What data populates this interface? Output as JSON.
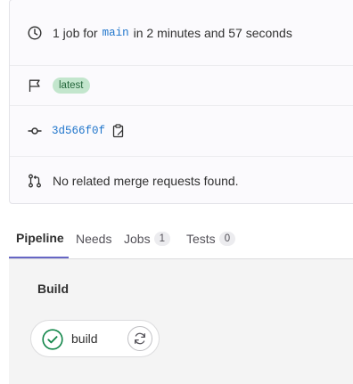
{
  "commit_info": {
    "job_count": "1 job for",
    "branch": "main",
    "duration": "in 2 minutes and 57 seconds",
    "tag": "latest",
    "commit_sha": "3d566f0f",
    "merge_requests": "No related merge requests found."
  },
  "tabs": [
    {
      "label": "Pipeline",
      "active": true
    },
    {
      "label": "Needs"
    },
    {
      "label": "Jobs",
      "count": "1"
    },
    {
      "label": "Tests",
      "count": "0"
    }
  ],
  "pipeline": {
    "stage": "Build",
    "job": {
      "name": "build",
      "status": "success",
      "status_icon": "check-circle-icon",
      "action_icon": "retry-icon"
    }
  },
  "colors": {
    "success": "#108548",
    "link": "#1f75cb",
    "tab_active_border": "#6666c4",
    "badge_bg": "#c3e6cd"
  }
}
